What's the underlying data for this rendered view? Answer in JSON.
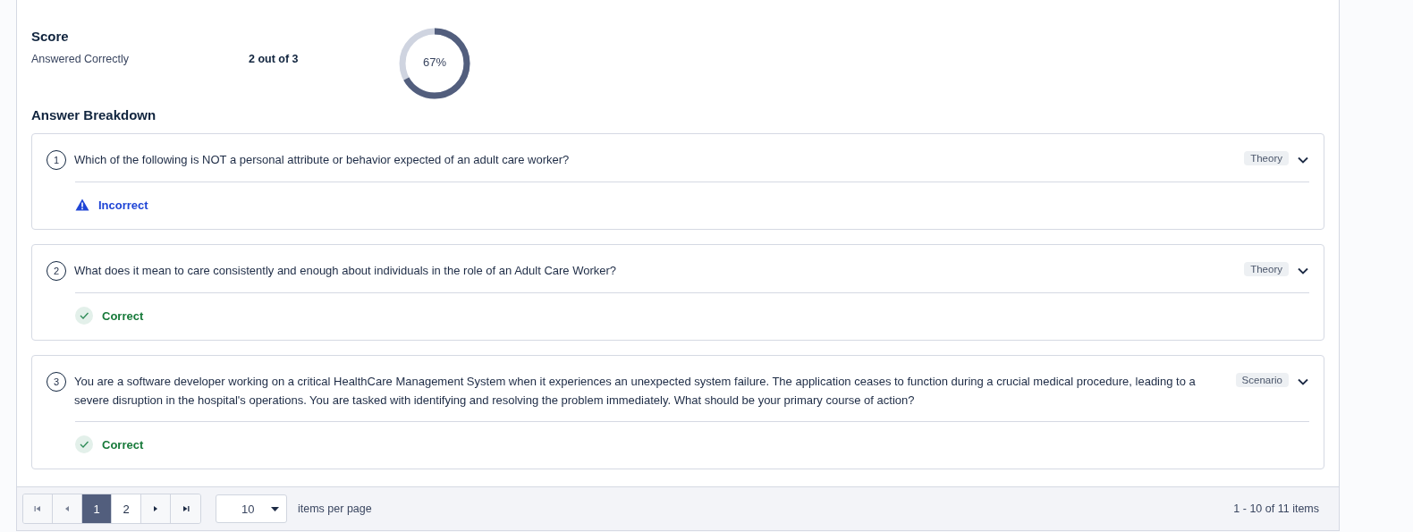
{
  "score": {
    "title": "Score",
    "label": "Answered Correctly",
    "value": "2 out of 3",
    "percent": "67%"
  },
  "breakdown": {
    "title": "Answer Breakdown",
    "questions": [
      {
        "number": "1",
        "text": "Which of the following is NOT a personal attribute or behavior expected of an adult care worker?",
        "tag": "Theory",
        "result": "Incorrect",
        "kind": "incorrect"
      },
      {
        "number": "2",
        "text": "What does it mean to care consistently and enough about individuals in the role of an Adult Care Worker?",
        "tag": "Theory",
        "result": "Correct",
        "kind": "correct"
      },
      {
        "number": "3",
        "text": "You are a software developer working on a critical HealthCare Management System when it experiences an unexpected system failure. The application ceases to function during a crucial medical procedure, leading to a severe disruption in the hospital's operations. You are tasked with identifying and resolving the problem immediately. What should be your primary course of action?",
        "tag": "Scenario",
        "result": "Correct",
        "kind": "correct"
      }
    ]
  },
  "pager": {
    "pages": [
      {
        "label": "1",
        "selected": true
      },
      {
        "label": "2",
        "selected": false
      }
    ],
    "page_size": "10",
    "page_size_label": "items per page",
    "summary": "1 - 10 of 11 items"
  }
}
